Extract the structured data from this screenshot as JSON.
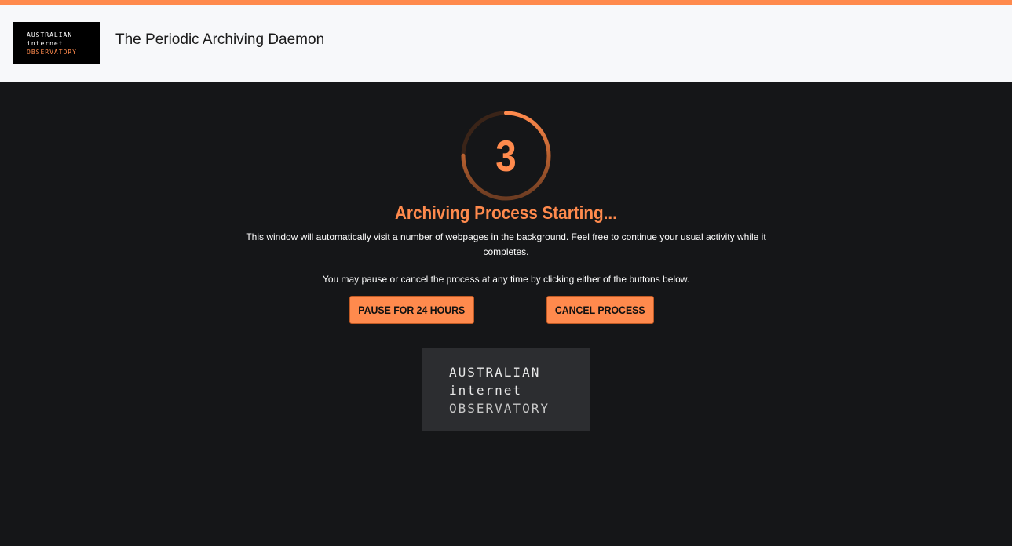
{
  "header": {
    "logo_lines": [
      "AUSTRALIAN",
      "internet",
      "OBSERVATORY"
    ],
    "title": "The Periodic Archiving Daemon"
  },
  "countdown": {
    "value": "3",
    "progress_fraction": 0.75
  },
  "main": {
    "status_title": "Archiving Process Starting...",
    "description": "This window will automatically visit a number of webpages in the background. Feel free to continue your usual activity while it completes.",
    "instructions": "You may pause or cancel the process at any time by clicking either of the buttons below.",
    "pause_label": "PAUSE FOR 24 HOURS",
    "cancel_label": "CANCEL PROCESS"
  },
  "footer": {
    "logo_lines": [
      "AUSTRALIAN",
      "internet",
      "OBSERVATORY"
    ]
  },
  "colors": {
    "accent": "#ff8a4d",
    "background": "#151618",
    "header_background": "#f7f8fa"
  }
}
